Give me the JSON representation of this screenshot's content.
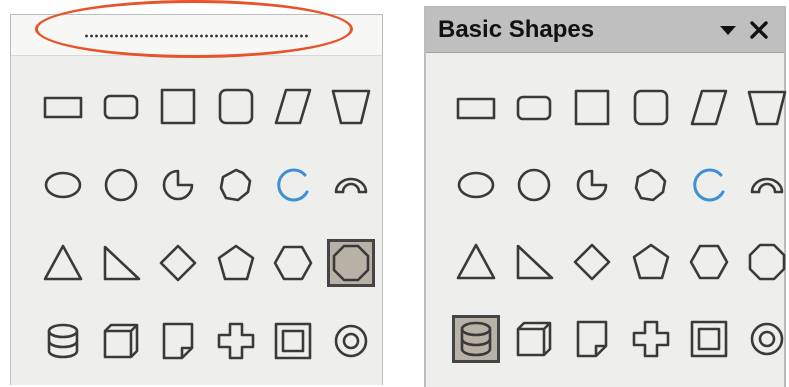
{
  "left_panel": {
    "selected": "octagon"
  },
  "right_panel": {
    "title": "Basic Shapes",
    "selected": "can"
  },
  "shapes": [
    [
      "rectangle",
      "rectangle-rounded",
      "square",
      "square-rounded",
      "parallelogram",
      "trapezoid"
    ],
    [
      "ellipse",
      "circle",
      "circle-pie",
      "block-arc",
      "arc",
      "circle-segment"
    ],
    [
      "isosceles-triangle",
      "right-triangle",
      "diamond",
      "pentagon",
      "hexagon",
      "octagon"
    ],
    [
      "can",
      "cube",
      "folded-corner",
      "cross",
      "frame",
      "ring"
    ]
  ],
  "colors": {
    "panel_bg": "#eeeeec",
    "titlebar_bg": "#bfbfbf",
    "shape_stroke": "#3a3a3a",
    "arc_accent": "#3d8fd6",
    "selection_bg": "#b8b1a5",
    "annotation_ring": "#e8532a"
  }
}
